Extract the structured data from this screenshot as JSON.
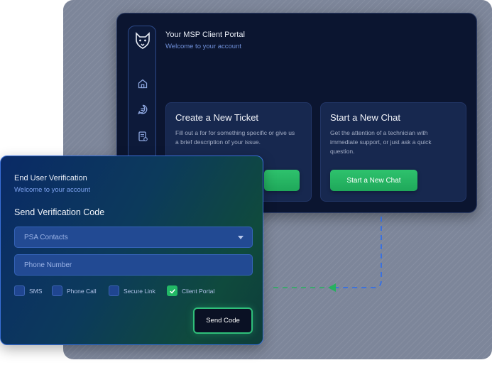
{
  "portal": {
    "title": "Your MSP Client Portal",
    "subtitle": "Welcome to your account",
    "sidebar_icons": [
      "wolf-logo-icon",
      "home-icon",
      "chat-icon",
      "document-icon",
      "ticket-icon"
    ],
    "cards": [
      {
        "title": "Create a New Ticket",
        "description": "Fill out a for for something specific or give us a brief description of your issue."
      },
      {
        "title": "Start a New Chat",
        "description": "Get the attention of a technician with immediate support, or just ask a quick question.",
        "button_label": "Start a New Chat"
      }
    ]
  },
  "verification": {
    "title": "End User Verification",
    "subtitle": "Welcome to your account",
    "heading": "Send Verification Code",
    "contact_select": {
      "value": "PSA Contacts"
    },
    "phone_input": {
      "placeholder": "Phone Number"
    },
    "options": [
      {
        "label": "SMS",
        "checked": false
      },
      {
        "label": "Phone Call",
        "checked": false
      },
      {
        "label": "Secure Link",
        "checked": false
      },
      {
        "label": "Client Portal",
        "checked": true
      }
    ],
    "send_button_label": "Send Code"
  },
  "colors": {
    "accent_green": "#22b866",
    "accent_blue": "#3a6fd8",
    "portal_bg": "#0b1530"
  }
}
